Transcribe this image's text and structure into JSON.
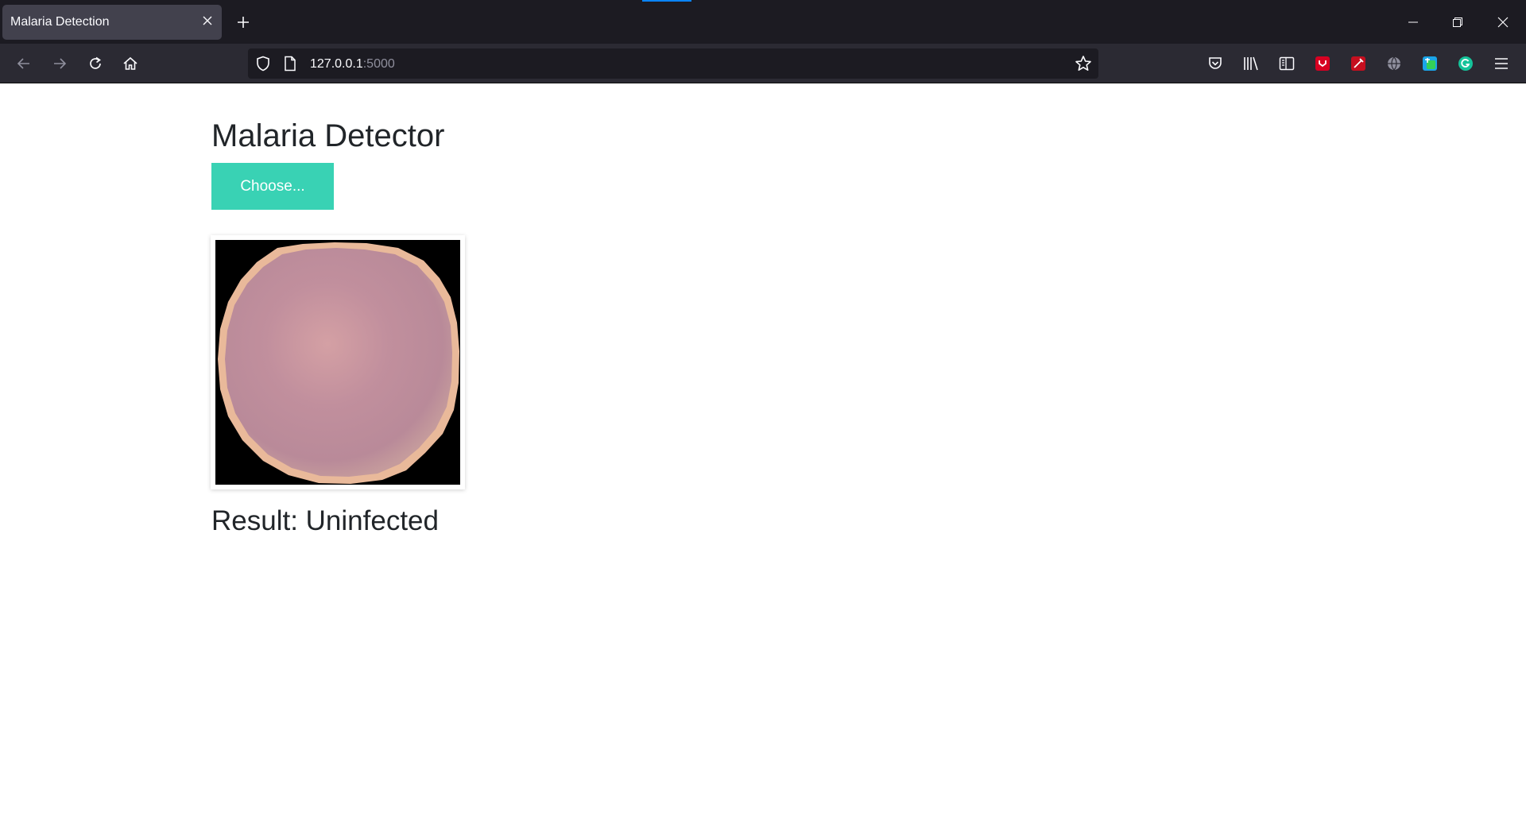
{
  "browser": {
    "tab": {
      "title": "Malaria Detection"
    },
    "url": {
      "host": "127.0.0.1",
      "port": ":5000"
    },
    "icons": {
      "tab_close": "close-icon",
      "new_tab": "plus-icon",
      "minimize": "minimize-icon",
      "restore": "restore-icon",
      "close_window": "close-icon",
      "back": "arrow-left-icon",
      "forward": "arrow-right-icon",
      "reload": "reload-icon",
      "home": "home-icon",
      "tracking_protection": "shield-icon",
      "page_info": "page-icon",
      "bookmark": "star-icon",
      "pocket": "pocket-icon",
      "library": "library-icon",
      "sidebar": "sidebar-icon",
      "menu": "hamburger-menu-icon"
    },
    "colors": {
      "tabstrip": "#1c1b22",
      "toolbar": "#2b2a33",
      "active_tab": "#42414d"
    }
  },
  "page": {
    "title": "Malaria Detector",
    "choose_button": "Choose...",
    "result": "Result: Uninfected",
    "colors": {
      "button": "#39d2b4",
      "text": "#212529"
    }
  }
}
